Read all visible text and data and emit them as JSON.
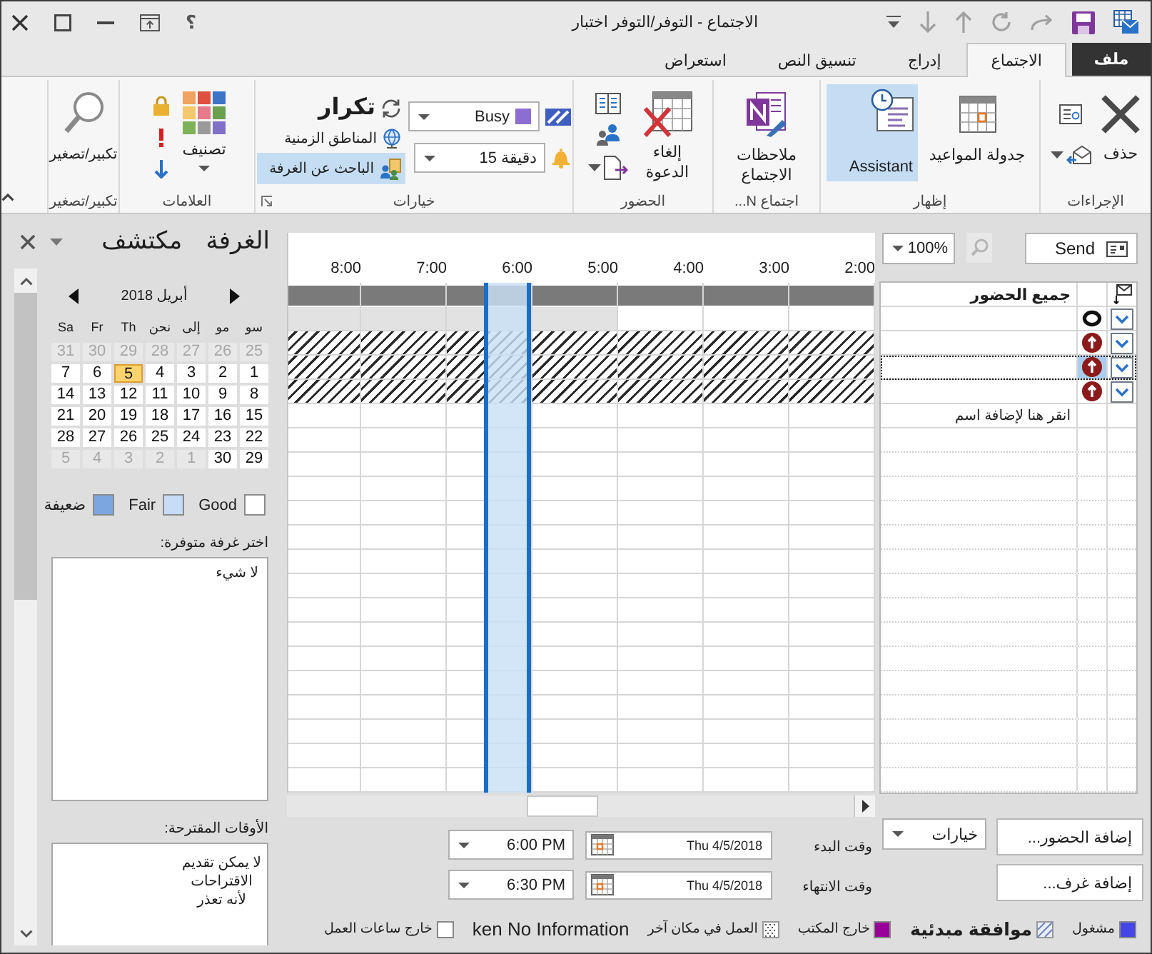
{
  "window": {
    "title": "الاجتماع - التوفر/التوفر اختبار",
    "help": "؟"
  },
  "file_tab": "ملف",
  "tabs": [
    {
      "label": "الاجتماع",
      "selected": true
    },
    {
      "label": "إدراج",
      "selected": false
    },
    {
      "label": "تنسيق النص",
      "selected": false
    },
    {
      "label": "استعراض",
      "selected": false
    }
  ],
  "ribbon": {
    "actions": {
      "label": "الإجراءات",
      "delete": "حذف"
    },
    "show": {
      "label": "إظهار",
      "buttons": [
        {
          "kind": "scheduling",
          "label": "جدولة المواعيد",
          "selected": false
        },
        {
          "kind": "assistant",
          "label": "Assistant",
          "selected": true
        }
      ]
    },
    "meeting_notes": {
      "label": "اجتماع N...",
      "button": "ملاحظات الاجتماع"
    },
    "attendees": {
      "label": "الحضور",
      "button": "إلغاء الدعوة"
    },
    "options": {
      "label": "خيارات",
      "show_as": "Busy",
      "reminder": "15 دقيقة",
      "toggles": [
        {
          "kind": "recurrence",
          "label": "تكرار",
          "selected": false
        },
        {
          "kind": "timezones",
          "label": "المناطق الزمنية",
          "selected": false
        },
        {
          "kind": "rooms",
          "label": "الباحث عن الغرفة",
          "selected": true
        }
      ]
    },
    "tags": {
      "label": "العلامات",
      "categorize": "تصنيف"
    },
    "zoom": {
      "label": "تكبير/تصغير",
      "button": "تكبير/تصغير"
    }
  },
  "room_finder": {
    "title": "الغرفة مكتشف",
    "month": "أبريل 2018",
    "weekdays": [
      "سو",
      "مو",
      "إلى",
      "نحن",
      "Th",
      "Fr",
      "Sa"
    ],
    "weeks": [
      [
        {
          "day": "25",
          "in_month": false,
          "selected": false
        },
        {
          "day": "26",
          "in_month": false,
          "selected": false
        },
        {
          "day": "27",
          "in_month": false,
          "selected": false
        },
        {
          "day": "28",
          "in_month": false,
          "selected": false
        },
        {
          "day": "29",
          "in_month": false,
          "selected": false
        },
        {
          "day": "30",
          "in_month": false,
          "selected": false
        },
        {
          "day": "31",
          "in_month": false,
          "selected": false
        }
      ],
      [
        {
          "day": "1",
          "in_month": true,
          "selected": false
        },
        {
          "day": "2",
          "in_month": true,
          "selected": false
        },
        {
          "day": "3",
          "in_month": true,
          "selected": false
        },
        {
          "day": "4",
          "in_month": true,
          "selected": false
        },
        {
          "day": "5",
          "in_month": true,
          "selected": true
        },
        {
          "day": "6",
          "in_month": true,
          "selected": false
        },
        {
          "day": "7",
          "in_month": true,
          "selected": false
        }
      ],
      [
        {
          "day": "8",
          "in_month": true,
          "selected": false
        },
        {
          "day": "9",
          "in_month": true,
          "selected": false
        },
        {
          "day": "10",
          "in_month": true,
          "selected": false
        },
        {
          "day": "11",
          "in_month": true,
          "selected": false
        },
        {
          "day": "12",
          "in_month": true,
          "selected": false
        },
        {
          "day": "13",
          "in_month": true,
          "selected": false
        },
        {
          "day": "14",
          "in_month": true,
          "selected": false
        }
      ],
      [
        {
          "day": "15",
          "in_month": true,
          "selected": false
        },
        {
          "day": "16",
          "in_month": true,
          "selected": false
        },
        {
          "day": "17",
          "in_month": true,
          "selected": false
        },
        {
          "day": "18",
          "in_month": true,
          "selected": false
        },
        {
          "day": "19",
          "in_month": true,
          "selected": false
        },
        {
          "day": "20",
          "in_month": true,
          "selected": false
        },
        {
          "day": "21",
          "in_month": true,
          "selected": false
        }
      ],
      [
        {
          "day": "22",
          "in_month": true,
          "selected": false
        },
        {
          "day": "23",
          "in_month": true,
          "selected": false
        },
        {
          "day": "24",
          "in_month": true,
          "selected": false
        },
        {
          "day": "25",
          "in_month": true,
          "selected": false
        },
        {
          "day": "26",
          "in_month": true,
          "selected": false
        },
        {
          "day": "27",
          "in_month": true,
          "selected": false
        },
        {
          "day": "28",
          "in_month": true,
          "selected": false
        }
      ],
      [
        {
          "day": "29",
          "in_month": true,
          "selected": false
        },
        {
          "day": "30",
          "in_month": true,
          "selected": false
        },
        {
          "day": "1",
          "in_month": false,
          "selected": false
        },
        {
          "day": "2",
          "in_month": false,
          "selected": false
        },
        {
          "day": "3",
          "in_month": false,
          "selected": false
        },
        {
          "day": "4",
          "in_month": false,
          "selected": false
        },
        {
          "day": "5",
          "in_month": false,
          "selected": false
        }
      ]
    ],
    "quality_legend": [
      {
        "label": "Good",
        "color": "#ffffff"
      },
      {
        "label": "Fair",
        "color": "#c6dcf7"
      },
      {
        "label": "ضعيفة",
        "color": "#7ba6df"
      }
    ],
    "rooms_label": "اختر غرفة متوفرة:",
    "rooms": [
      "لا شيء"
    ],
    "suggested_label": "الأوقات المقترحة:",
    "suggested_message": "لا يمكن تقديم\nالاقتراحات\nلأنه تعذر"
  },
  "scheduling": {
    "send": "Send",
    "zoom": "100%",
    "hours": [
      {
        "label": "2:00",
        "selected": false
      },
      {
        "label": "3:00",
        "selected": false
      },
      {
        "label": "4:00",
        "selected": false
      },
      {
        "label": "5:00",
        "selected": false
      },
      {
        "label": "6:00",
        "selected": true
      },
      {
        "label": "7:00",
        "selected": false
      },
      {
        "label": "8:00",
        "selected": false
      }
    ],
    "all_attendees": "جميع الحضور",
    "attendees": [
      {
        "kind": "organizer",
        "selected": false,
        "cells": [
          {
            "kind": "free"
          },
          {
            "kind": "free"
          },
          {
            "kind": "free"
          },
          {
            "kind": "off"
          },
          {
            "kind": "off"
          },
          {
            "kind": "off"
          },
          {
            "kind": "off"
          }
        ]
      },
      {
        "kind": "required",
        "selected": false,
        "cells": [
          {
            "kind": "unknown"
          },
          {
            "kind": "unknown"
          },
          {
            "kind": "unknown"
          },
          {
            "kind": "unknown"
          },
          {
            "kind": "unknown"
          },
          {
            "kind": "unknown"
          },
          {
            "kind": "unknown"
          }
        ]
      },
      {
        "kind": "required",
        "selected": true,
        "cells": [
          {
            "kind": "unknown"
          },
          {
            "kind": "unknown"
          },
          {
            "kind": "unknown"
          },
          {
            "kind": "unknown"
          },
          {
            "kind": "unknown"
          },
          {
            "kind": "unknown"
          },
          {
            "kind": "unknown"
          }
        ]
      },
      {
        "kind": "required",
        "selected": false,
        "cells": [
          {
            "kind": "unknown"
          },
          {
            "kind": "unknown"
          },
          {
            "kind": "unknown"
          },
          {
            "kind": "unknown"
          },
          {
            "kind": "unknown"
          },
          {
            "kind": "unknown"
          },
          {
            "kind": "unknown"
          }
        ]
      }
    ],
    "add_placeholder": "انقر هنا لإضافة اسم"
  },
  "form": {
    "add_attendees": "إضافة الحضور...",
    "add_rooms": "إضافة غرف...",
    "options": "خيارات",
    "start_label": "وقت البدء",
    "start_date": "Thu 4/5/2018",
    "start_time": "6:00 PM",
    "end_label": "وقت الانتهاء",
    "end_date": "Thu 4/5/2018",
    "end_time": "6:30 PM"
  },
  "legend": [
    {
      "kind": "solid",
      "color": "#4646e6",
      "label": "مشغول"
    },
    {
      "kind": "hatch",
      "label": "موافقة مبدئية"
    },
    {
      "kind": "solid",
      "color": "#990099",
      "label": "خارج المكتب"
    },
    {
      "kind": "dots",
      "label": "العمل في مكان آخر"
    },
    {
      "kind": "none",
      "label": "ken No Information"
    },
    {
      "kind": "solid",
      "color": "#ffffff",
      "label": "خارج ساعات العمل"
    }
  ]
}
